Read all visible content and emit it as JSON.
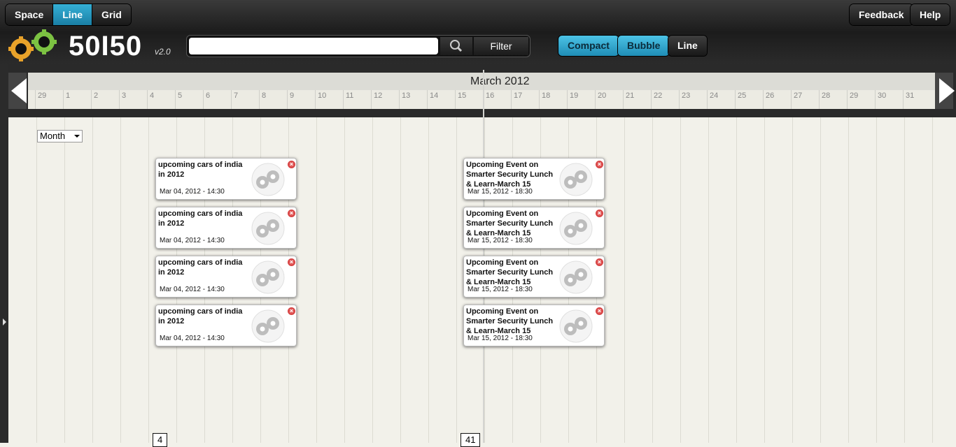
{
  "nav": {
    "space": "Space",
    "line": "Line",
    "grid": "Grid",
    "feedback": "Feedback",
    "help": "Help"
  },
  "logo": {
    "text": "50I50",
    "version": "v2.0"
  },
  "search": {
    "value": "",
    "placeholder": "",
    "filter_label": "Filter"
  },
  "views": {
    "compact": "Compact",
    "bubble": "Bubble",
    "line": "Line"
  },
  "timeline": {
    "title": "March 2012",
    "days": [
      "29",
      "1",
      "2",
      "3",
      "4",
      "5",
      "6",
      "7",
      "8",
      "9",
      "10",
      "11",
      "12",
      "13",
      "14",
      "15",
      "16",
      "17",
      "18",
      "19",
      "20",
      "21",
      "22",
      "23",
      "24",
      "25",
      "26",
      "27",
      "28",
      "29",
      "30",
      "31"
    ]
  },
  "range_select": {
    "value": "Month"
  },
  "groups": [
    {
      "count": "4",
      "cards": [
        {
          "title": "upcoming cars of india in 2012",
          "date": "Mar 04, 2012 - 14:30"
        },
        {
          "title": "upcoming cars of india in 2012",
          "date": "Mar 04, 2012 - 14:30"
        },
        {
          "title": "upcoming cars of india in 2012",
          "date": "Mar 04, 2012 - 14:30"
        },
        {
          "title": "upcoming cars of india in 2012",
          "date": "Mar 04, 2012 - 14:30"
        }
      ]
    },
    {
      "count": "41",
      "cards": [
        {
          "title": "Upcoming Event on Smarter Security Lunch & Learn-March 15",
          "date": "Mar 15, 2012 - 18:30"
        },
        {
          "title": "Upcoming Event on Smarter Security Lunch & Learn-March 15",
          "date": "Mar 15, 2012 - 18:30"
        },
        {
          "title": "Upcoming Event on Smarter Security Lunch & Learn-March 15",
          "date": "Mar 15, 2012 - 18:30"
        },
        {
          "title": "Upcoming Event on Smarter Security Lunch & Learn-March 15",
          "date": "Mar 15, 2012 - 18:30"
        }
      ]
    }
  ]
}
